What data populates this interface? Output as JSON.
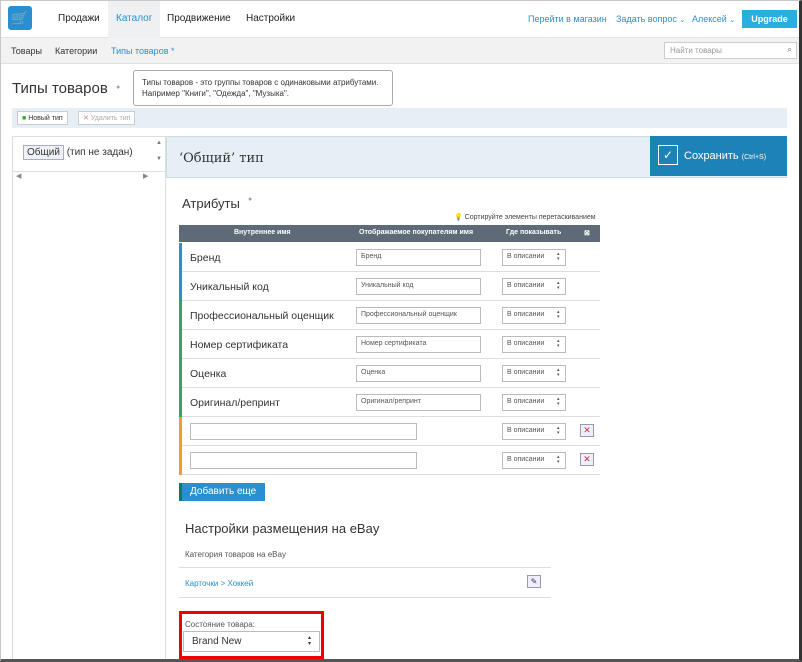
{
  "topnav": {
    "items": [
      "Продажи",
      "Каталог",
      "Продвижение",
      "Настройки"
    ],
    "store_link": "Перейти в магазин",
    "ask_link": "Задать вопрос",
    "user": "Алексей",
    "upgrade": "Upgrade"
  },
  "subnav": {
    "items": [
      "Товары",
      "Категории",
      "Типы товаров *"
    ],
    "search_placeholder": "Найти товары"
  },
  "page": {
    "title": "Типы товаров",
    "tooltip": "Типы товаров - это группы товаров с одинаковыми атрибутами. Например \"Книги\", \"Одежда\", \"Музыка\"."
  },
  "toolbar": {
    "new_type": "Новый тип",
    "delete_type": "Удалить тип"
  },
  "left": {
    "tag": "Общий",
    "note": "(тип не задан)"
  },
  "editor": {
    "title": "‘Общий’ тип",
    "save": "Сохранить",
    "save_hint": "(Ctrl+S)"
  },
  "attributes": {
    "heading": "Атрибуты",
    "sort_hint": "Сортируйте элементы перетаскиванием",
    "columns": [
      "Внутреннее имя",
      "Отображаемое покупателям имя",
      "Где показывать"
    ],
    "rows": [
      {
        "name": "Бренд",
        "display": "Бренд",
        "where": "В описании",
        "color": "#2a8fd0"
      },
      {
        "name": "Уникальный код",
        "display": "Уникальный код",
        "where": "В описании",
        "color": "#2a8fd0"
      },
      {
        "name": "Профессиональный оценщик",
        "display": "Профессиональный оценщик",
        "where": "В описании",
        "color": "#3aa655"
      },
      {
        "name": "Номер сертификата",
        "display": "Номер сертификата",
        "where": "В описании",
        "color": "#3aa655"
      },
      {
        "name": "Оценка",
        "display": "Оценка",
        "where": "В описании",
        "color": "#3aa655"
      },
      {
        "name": "Оригинал/репринт",
        "display": "Оригинал/репринт",
        "where": "В описании",
        "color": "#3aa655"
      }
    ],
    "custom_rows": [
      {
        "where": "В описании",
        "color": "#f0a020"
      },
      {
        "where": "В описании",
        "color": "#f0a020"
      }
    ],
    "add_more": "Добавить еще"
  },
  "ebay": {
    "heading": "Настройки размещения на eBay",
    "category_label": "Категория товаров на eBay",
    "category_path": "Карточки > Хоккей",
    "condition_label": "Состояние товара:",
    "condition_value": "Brand New"
  }
}
